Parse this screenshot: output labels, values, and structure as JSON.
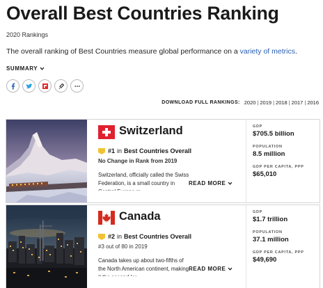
{
  "page": {
    "title": "Overall Best Countries Ranking",
    "subtitle": "2020 Rankings",
    "intro_text": "The overall ranking of Best Countries measure global performance on a ",
    "intro_link": "variety of metrics",
    "intro_end": ".",
    "summary_label": "SUMMARY",
    "download_label": "DOWNLOAD FULL RANKINGS:",
    "years": [
      "2020",
      "2019",
      "2018",
      "2017",
      "2016"
    ]
  },
  "share_icons": [
    "facebook-icon",
    "twitter-icon",
    "flipboard-icon",
    "link-icon",
    "more-icon"
  ],
  "cards": [
    {
      "country": "Switzerland",
      "rank": "#1",
      "rank_in": "in",
      "category": "Best Countries Overall",
      "rank_sub": "No Change in Rank from 2019",
      "description": "Switzerland, officially called the Swiss Federation, is a small country in Central Europe m",
      "description_fade": "...",
      "read_more": "READ MORE",
      "stats": [
        {
          "label": "GDP",
          "value": "$705.5 billion"
        },
        {
          "label": "POPULATION",
          "value": "8.5 million"
        },
        {
          "label": "GDP PER CAPITA, PPP",
          "value": "$65,010"
        }
      ]
    },
    {
      "country": "Canada",
      "rank": "#2",
      "rank_in": "in",
      "category": "Best Countries Overall",
      "rank_sub": "#3 out of 80 in 2019",
      "description": "Canada takes up about two-fifths of the North American continent, making it the second-lar",
      "description_fade": "...",
      "read_more": "READ MORE",
      "stats": [
        {
          "label": "GDP",
          "value": "$1.7 trillion"
        },
        {
          "label": "POPULATION",
          "value": "37.1 million"
        },
        {
          "label": "GDP PER CAPITA, PPP",
          "value": "$49,690"
        }
      ]
    }
  ],
  "colors": {
    "link": "#2a5db0",
    "swiss_red": "#e0202e",
    "canada_red": "#d52b1e",
    "medal": "#f2c233",
    "facebook": "#2f63b5",
    "twitter": "#2aa3e8",
    "flipboard": "#e12828"
  }
}
